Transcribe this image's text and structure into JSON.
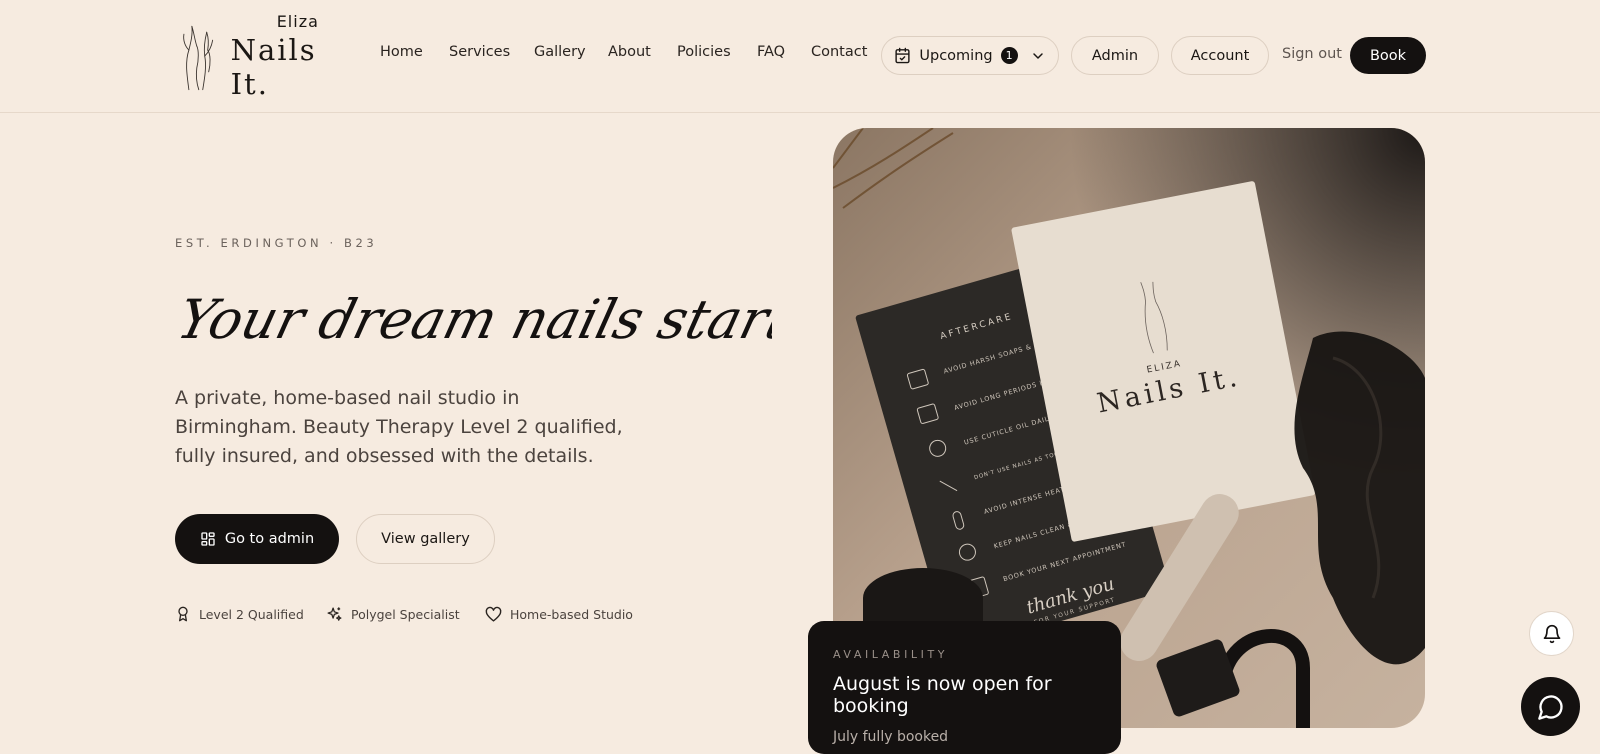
{
  "brand": {
    "top": "Eliza",
    "name": "Nails It."
  },
  "nav": [
    "Home",
    "Services",
    "Gallery",
    "About",
    "Policies",
    "FAQ",
    "Contact"
  ],
  "header_actions": {
    "upcoming_label": "Upcoming",
    "upcoming_count": "1",
    "admin": "Admin",
    "account": "Account",
    "sign_out": "Sign out",
    "book": "Book"
  },
  "hero": {
    "eyebrow": "EST. ERDINGTON · B23",
    "headline": "Your dream nails start here...",
    "description": "A private, home-based nail studio in Birmingham. Beauty Therapy Level 2 qualified, fully insured, and obsessed with the details.",
    "primary_button": "Go to admin",
    "secondary_button": "View gallery",
    "features": [
      {
        "icon": "award-icon",
        "label": "Level 2 Qualified"
      },
      {
        "icon": "sparkles-icon",
        "label": "Polygel Specialist"
      },
      {
        "icon": "heart-icon",
        "label": "Home-based Studio"
      }
    ]
  },
  "photo": {
    "card_brand_top": "ELIZA",
    "card_brand_name": "Nails It.",
    "aftercare_title": "AFTERCARE",
    "aftercare_items": [
      "AVOID HARSH SOAPS & CHEMICALS",
      "AVOID LONG PERIODS IN WATER",
      "USE CUTICLE OIL DAILY",
      "DON'T USE NAILS AS TOOLS. NEVER PICK OR PEEL PRODUCTS OFF",
      "AVOID INTENSE HEAT",
      "KEEP NAILS CLEAN & DRY",
      "BOOK YOUR NEXT APPOINTMENT"
    ],
    "thank_you": "thank you",
    "thank_you_sub": "FOR YOUR SUPPORT"
  },
  "availability": {
    "label": "AVAILABILITY",
    "title": "August is now open for booking",
    "subtitle": "July fully booked"
  },
  "colors": {
    "background": "#f6ebe0",
    "dark": "#141110",
    "border": "#ddcfc1",
    "muted_text": "#4b433e"
  }
}
